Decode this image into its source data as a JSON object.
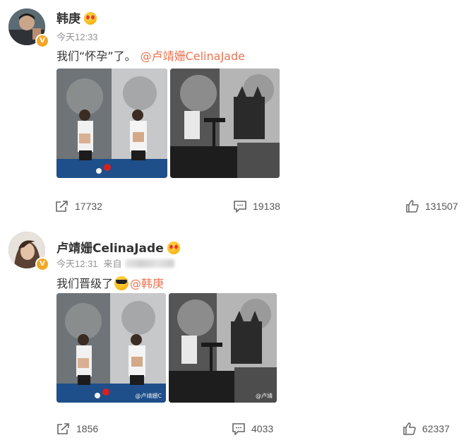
{
  "posts": [
    {
      "user": {
        "name": "韩庚",
        "verified": true,
        "badge_icon": "verified-v-icon",
        "name_emoji": "heart-eyes-emoji"
      },
      "time": "今天12:33",
      "text_plain": "我们“怀孕”了。",
      "mention": "@卢靖姗CelinaJade",
      "images": [
        "couple-billiard-photo",
        "bw-cats-photo"
      ],
      "actions": {
        "share": "17732",
        "comment": "19138",
        "like": "131507"
      }
    },
    {
      "user": {
        "name": "卢靖姗CelinaJade",
        "verified": true,
        "badge_icon": "verified-v-icon",
        "name_emoji": "heart-eyes-emoji"
      },
      "time": "今天12:31",
      "source_label": "来自",
      "text_plain": "我们晋级了",
      "text_emoji": "sunglasses-emoji",
      "mention": "@韩庚",
      "images": [
        "couple-billiard-photo",
        "bw-cats-photo"
      ],
      "watermarks": [
        "@卢靖姗C",
        "@卢靖"
      ],
      "actions": {
        "share": "1856",
        "comment": "4033",
        "like": "62337"
      }
    }
  ],
  "colors": {
    "mention": "#eb7350",
    "meta": "#939393",
    "verified": "#f5a623"
  }
}
